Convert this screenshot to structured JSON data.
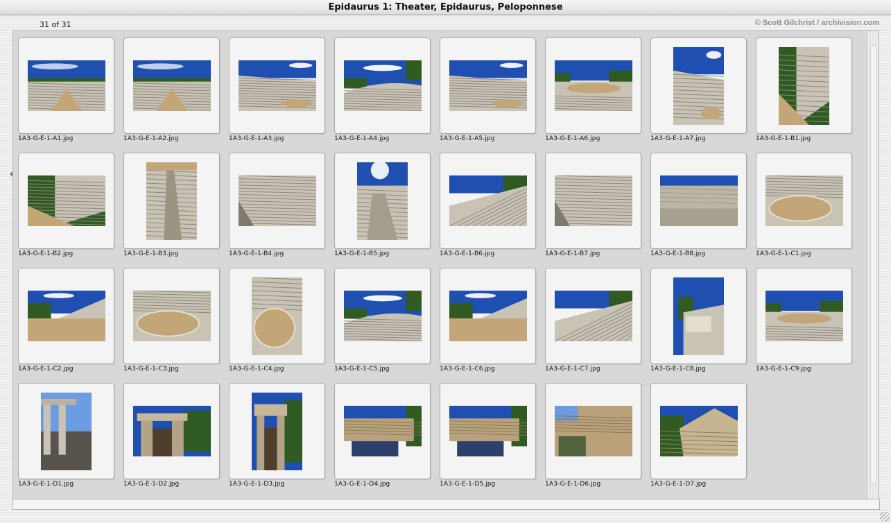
{
  "window": {
    "title": "Epidaurus 1: Theater, Epidaurus, Peloponnese"
  },
  "header": {
    "count": "31 of 31",
    "credit": "© Scott Gilchrist / archivision.com"
  },
  "thumbnails": [
    {
      "file": "1A3-G-E-1-A1.jpg",
      "orientation": "landscape",
      "scene": "theater-wide"
    },
    {
      "file": "1A3-G-E-1-A2.jpg",
      "orientation": "landscape",
      "scene": "theater-wide"
    },
    {
      "file": "1A3-G-E-1-A3.jpg",
      "orientation": "landscape",
      "scene": "theater-seats-sky"
    },
    {
      "file": "1A3-G-E-1-A4.jpg",
      "orientation": "landscape",
      "scene": "theater-curve"
    },
    {
      "file": "1A3-G-E-1-A5.jpg",
      "orientation": "landscape",
      "scene": "theater-seats-sky"
    },
    {
      "file": "1A3-G-E-1-A6.jpg",
      "orientation": "landscape",
      "scene": "theater-stage"
    },
    {
      "file": "1A3-G-E-1-A7.jpg",
      "orientation": "portrait",
      "scene": "theater-seats-sky"
    },
    {
      "file": "1A3-G-E-1-B1.jpg",
      "orientation": "portrait",
      "scene": "aisle-tree"
    },
    {
      "file": "1A3-G-E-1-B2.jpg",
      "orientation": "landscape",
      "scene": "aisle-tree"
    },
    {
      "file": "1A3-G-E-1-B3.jpg",
      "orientation": "portrait",
      "scene": "stairs"
    },
    {
      "file": "1A3-G-E-1-B4.jpg",
      "orientation": "landscape",
      "scene": "seats-only"
    },
    {
      "file": "1A3-G-E-1-B5.jpg",
      "orientation": "portrait",
      "scene": "sun-seats"
    },
    {
      "file": "1A3-G-E-1-B6.jpg",
      "orientation": "landscape",
      "scene": "seats-diagonal"
    },
    {
      "file": "1A3-G-E-1-B7.jpg",
      "orientation": "landscape",
      "scene": "seats-only"
    },
    {
      "file": "1A3-G-E-1-B8.jpg",
      "orientation": "landscape",
      "scene": "wall"
    },
    {
      "file": "1A3-G-E-1-C1.jpg",
      "orientation": "landscape",
      "scene": "orchestra-circle"
    },
    {
      "file": "1A3-G-E-1-C2.jpg",
      "orientation": "landscape",
      "scene": "orchestra-tree"
    },
    {
      "file": "1A3-G-E-1-C3.jpg",
      "orientation": "landscape",
      "scene": "orchestra-circle"
    },
    {
      "file": "1A3-G-E-1-C4.jpg",
      "orientation": "portrait",
      "scene": "orchestra-circle"
    },
    {
      "file": "1A3-G-E-1-C5.jpg",
      "orientation": "landscape",
      "scene": "theater-curve"
    },
    {
      "file": "1A3-G-E-1-C6.jpg",
      "orientation": "landscape",
      "scene": "orchestra-tree"
    },
    {
      "file": "1A3-G-E-1-C7.jpg",
      "orientation": "landscape",
      "scene": "seats-diagonal"
    },
    {
      "file": "1A3-G-E-1-C8.jpg",
      "orientation": "portrait",
      "scene": "stone-block"
    },
    {
      "file": "1A3-G-E-1-C9.jpg",
      "orientation": "landscape",
      "scene": "theater-stage"
    },
    {
      "file": "1A3-G-E-1-D1.jpg",
      "orientation": "portrait",
      "scene": "columns"
    },
    {
      "file": "1A3-G-E-1-D2.jpg",
      "orientation": "landscape",
      "scene": "gate-trees"
    },
    {
      "file": "1A3-G-E-1-D3.jpg",
      "orientation": "portrait",
      "scene": "gate-trees"
    },
    {
      "file": "1A3-G-E-1-D4.jpg",
      "orientation": "landscape",
      "scene": "entablature"
    },
    {
      "file": "1A3-G-E-1-D5.jpg",
      "orientation": "landscape",
      "scene": "entablature"
    },
    {
      "file": "1A3-G-E-1-D6.jpg",
      "orientation": "landscape",
      "scene": "lintel-close"
    },
    {
      "file": "1A3-G-E-1-D7.jpg",
      "orientation": "landscape",
      "scene": "gate-corner"
    }
  ]
}
